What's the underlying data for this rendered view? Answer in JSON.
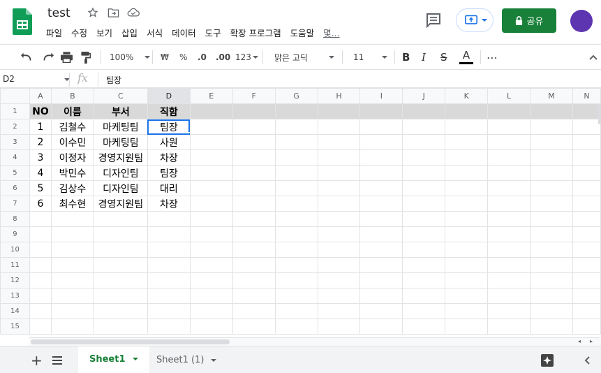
{
  "app": {
    "doc_title": "test",
    "menu": [
      "파일",
      "수정",
      "보기",
      "삽입",
      "서식",
      "데이터",
      "도구",
      "확장 프로그램",
      "도움말",
      "몇..."
    ],
    "share_label": "공유",
    "avatar_color": "#5e35b1",
    "share_color": "#188038",
    "accent_color": "#1a73e8"
  },
  "toolbar": {
    "zoom": "100%",
    "currency": "₩",
    "percent": "%",
    "decrease_decimal": ".0",
    "increase_decimal": ".00",
    "number_format": "123",
    "font": "맑은 고딕",
    "font_size": "11",
    "bold": "B",
    "italic": "I",
    "strike": "S",
    "text_color": "A",
    "more": "⋯"
  },
  "formula_bar": {
    "cell_ref": "D2",
    "fx": "fx",
    "value": "팀장"
  },
  "grid": {
    "columns": [
      "A",
      "B",
      "C",
      "D",
      "E",
      "F",
      "G",
      "H",
      "I",
      "J",
      "K",
      "L",
      "M",
      "N"
    ],
    "row_numbers": [
      "1",
      "2",
      "3",
      "4",
      "5",
      "6",
      "7",
      "8",
      "9",
      "10",
      "11",
      "12",
      "13",
      "14",
      "15"
    ],
    "rows": [
      [
        "NO",
        "이름",
        "부서",
        "직함"
      ],
      [
        "1",
        "김철수",
        "마케팅팀",
        "팀장"
      ],
      [
        "2",
        "이수민",
        "마케팅팀",
        "사원"
      ],
      [
        "3",
        "이정자",
        "경영지원팀",
        "차장"
      ],
      [
        "4",
        "박민수",
        "디자인팀",
        "팀장"
      ],
      [
        "5",
        "김상수",
        "디자인팀",
        "대리"
      ],
      [
        "6",
        "최수현",
        "경영지원팀",
        "차장"
      ]
    ],
    "selected_cell": "D2"
  },
  "sheets": {
    "tabs": [
      "Sheet1",
      "Sheet1 (1)"
    ],
    "active": "Sheet1"
  }
}
